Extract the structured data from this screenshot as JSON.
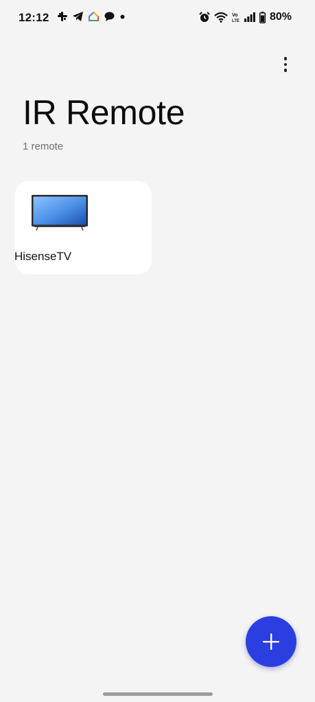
{
  "status_bar": {
    "time": "12:12",
    "left_icons": [
      "slack-icon",
      "telegram-icon",
      "google-home-icon",
      "chat-bubble-icon",
      "dot-icon"
    ],
    "right_icons": [
      "alarm-icon",
      "wifi-icon",
      "volte-icon",
      "signal-icon",
      "battery-icon"
    ],
    "volte_label": "Vo LTE",
    "battery_percent": "80%",
    "battery_level": 0.8
  },
  "header": {
    "title": "IR Remote",
    "subtitle": "1 remote"
  },
  "remotes": [
    {
      "name": "HisenseTV",
      "icon": "tv-icon"
    }
  ],
  "fab": {
    "icon": "plus-icon",
    "color": "#2b3fe0"
  },
  "colors": {
    "background": "#f4f4f4",
    "card": "#ffffff",
    "accent": "#2b3fe0"
  }
}
